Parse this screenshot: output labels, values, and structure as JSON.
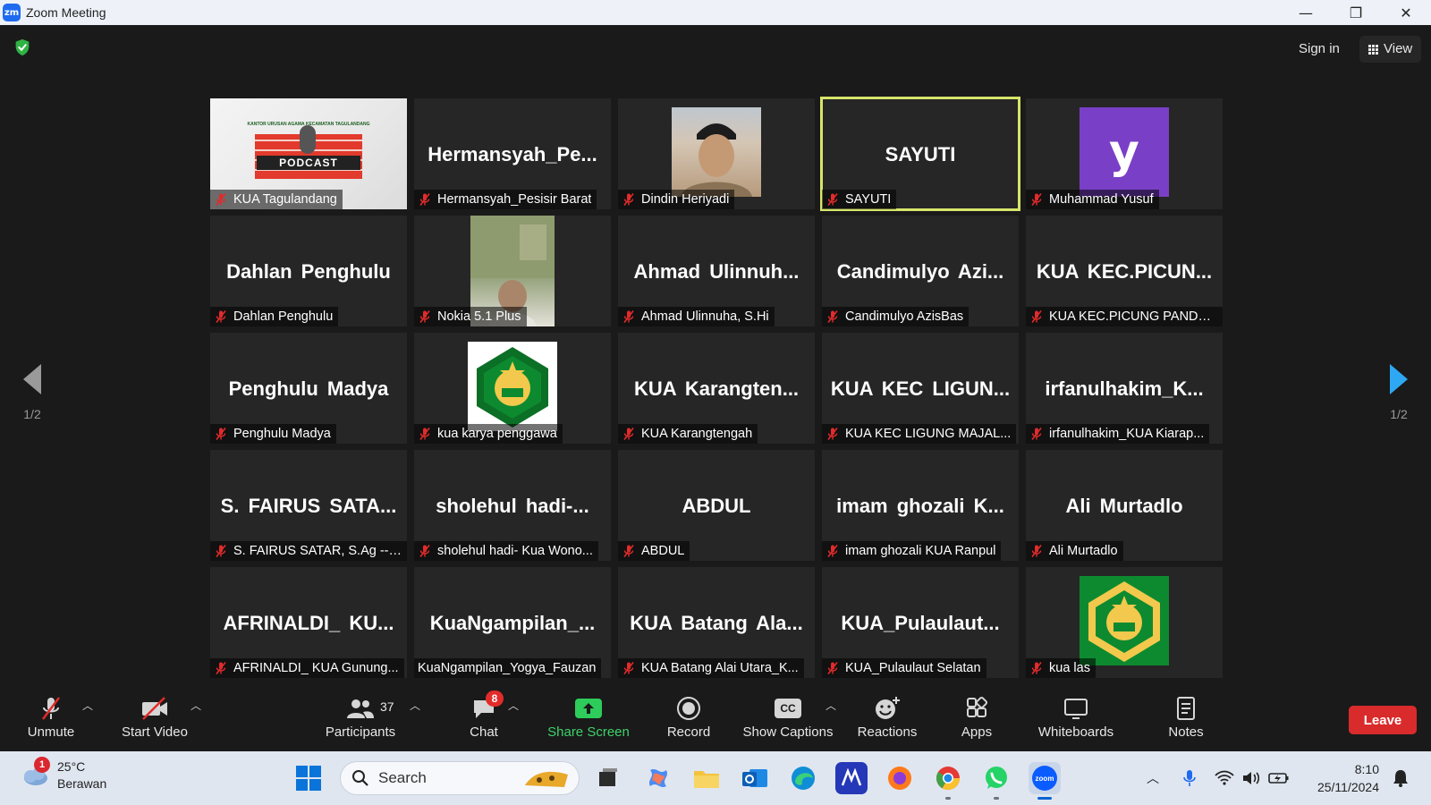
{
  "window": {
    "title": "Zoom Meeting",
    "logo_text": "zm",
    "controls": {
      "minimize": "—",
      "restore": "❐",
      "close": "✕"
    }
  },
  "topbar": {
    "signin_label": "Sign in",
    "view_label": "View"
  },
  "gallery": {
    "page_left": "1/2",
    "page_right": "1/2",
    "tiles": [
      {
        "big": "",
        "name": "KUA Tagulandang",
        "kind": "podcast",
        "podcast_label": "PODCAST",
        "podcast_title": "KANTOR URUSAN AGAMA KECAMATAN TAGULANDANG"
      },
      {
        "big": "Hermansyah_Pe...",
        "name": "Hermansyah_Pesisir Barat",
        "kind": "text"
      },
      {
        "big": "",
        "name": "Dindin Heriyadi",
        "kind": "photo"
      },
      {
        "big": "SAYUTI",
        "name": "SAYUTI",
        "kind": "text",
        "active": true
      },
      {
        "big": "",
        "name": "Muhammad Yusuf",
        "kind": "avatar",
        "letter": "y"
      },
      {
        "big": "Dahlan Penghulu",
        "name": "Dahlan Penghulu",
        "kind": "text"
      },
      {
        "big": "",
        "name": "Nokia 5.1 Plus",
        "kind": "video"
      },
      {
        "big": "Ahmad Ulinnuh...",
        "name": "Ahmad Ulinnuha, S.Hi",
        "kind": "text"
      },
      {
        "big": "Candimulyo Azi...",
        "name": "Candimulyo AzisBas",
        "kind": "text"
      },
      {
        "big": "KUA KEC.PICUN...",
        "name": "KUA KEC.PICUNG PANDE...",
        "kind": "text"
      },
      {
        "big": "Penghulu Madya",
        "name": "Penghulu Madya",
        "kind": "text"
      },
      {
        "big": "",
        "name": "kua karya penggawa",
        "kind": "logo-white"
      },
      {
        "big": "KUA Karangten...",
        "name": "KUA Karangtengah",
        "kind": "text"
      },
      {
        "big": "KUA KEC LIGUN...",
        "name": "KUA KEC LIGUNG MAJAL...",
        "kind": "text"
      },
      {
        "big": "irfanulhakim_K...",
        "name": "irfanulhakim_KUA Kiarap...",
        "kind": "text"
      },
      {
        "big": "S. FAIRUS SATA...",
        "name": "S. FAIRUS SATAR, S.Ag --A...",
        "kind": "text"
      },
      {
        "big": "sholehul hadi-...",
        "name": "sholehul hadi- Kua Wono...",
        "kind": "text"
      },
      {
        "big": "ABDUL",
        "name": "ABDUL",
        "kind": "text"
      },
      {
        "big": "imam ghozali K...",
        "name": "imam ghozali KUA Ranpul",
        "kind": "text"
      },
      {
        "big": "Ali Murtadlo",
        "name": "Ali Murtadlo",
        "kind": "text"
      },
      {
        "big": "AFRINALDI_ KU...",
        "name": "AFRINALDI_ KUA Gunung...",
        "kind": "text"
      },
      {
        "big": "KuaNgampilan_...",
        "name": "KuaNgampilan_Yogya_Fauzan",
        "kind": "text",
        "unmuted": true
      },
      {
        "big": "KUA Batang Ala...",
        "name": "KUA Batang Alai Utara_K...",
        "kind": "text"
      },
      {
        "big": "KUA_Pulaulaut...",
        "name": "KUA_Pulaulaut Selatan",
        "kind": "text"
      },
      {
        "big": "",
        "name": "kua las",
        "kind": "logo-green"
      }
    ]
  },
  "toolbar": {
    "unmute": "Unmute",
    "start_video": "Start Video",
    "participants": "Participants",
    "participants_count": "37",
    "chat": "Chat",
    "chat_badge": "8",
    "share_screen": "Share Screen",
    "record": "Record",
    "captions": "Show Captions",
    "captions_icon": "CC",
    "reactions": "Reactions",
    "apps": "Apps",
    "whiteboards": "Whiteboards",
    "notes": "Notes",
    "leave": "Leave"
  },
  "taskbar": {
    "weather_temp": "25°C",
    "weather_desc": "Berawan",
    "weather_badge": "1",
    "search_placeholder": "Search",
    "time": "8:10",
    "date": "25/11/2024",
    "zoom_label": "zoom"
  },
  "colors": {
    "accent_green": "#3fd26b",
    "leave_red": "#d92b2b",
    "active_speaker": "#d7e56a",
    "nav_blue": "#2ea8f2"
  }
}
